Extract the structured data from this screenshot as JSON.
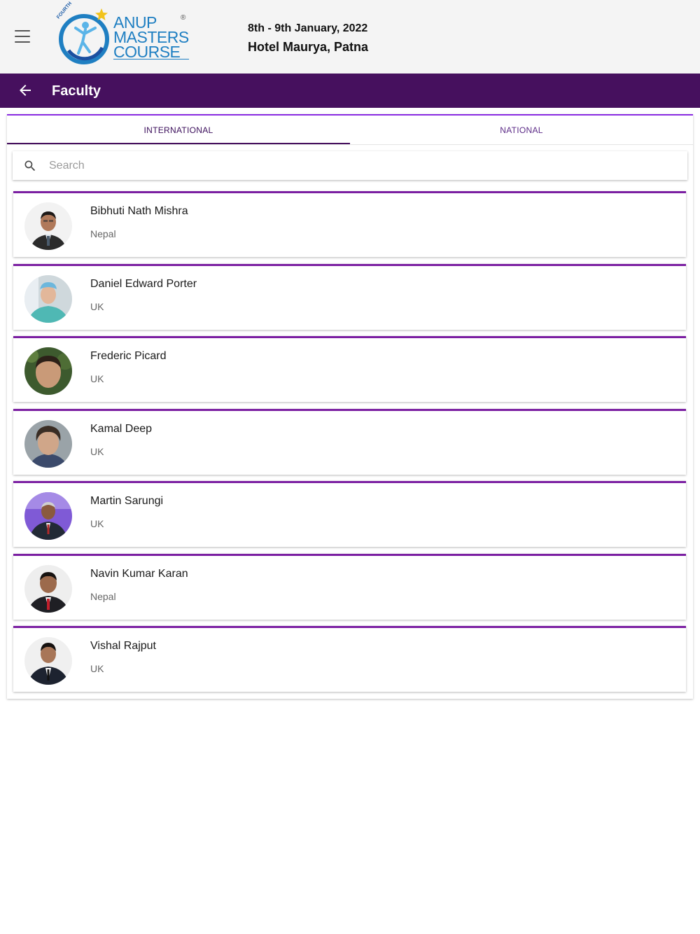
{
  "header": {
    "logo": {
      "words": [
        "ANUP",
        "MASTERS",
        "COURSE"
      ],
      "edition": "FOURTH",
      "mark": "®"
    },
    "event_dates": "8th - 9th January, 2022",
    "event_venue": "Hotel Maurya, Patna"
  },
  "app_bar": {
    "title": "Faculty"
  },
  "tabs": [
    {
      "label": "INTERNATIONAL",
      "active": true
    },
    {
      "label": "NATIONAL",
      "active": false
    }
  ],
  "search": {
    "placeholder": "Search",
    "value": ""
  },
  "faculty": [
    {
      "name": "Bibhuti Nath Mishra",
      "country": "Nepal"
    },
    {
      "name": "Daniel Edward Porter",
      "country": "UK"
    },
    {
      "name": "Frederic Picard",
      "country": "UK"
    },
    {
      "name": "Kamal Deep",
      "country": "UK"
    },
    {
      "name": "Martin Sarungi",
      "country": "UK"
    },
    {
      "name": "Navin Kumar Karan",
      "country": "Nepal"
    },
    {
      "name": "Vishal Rajput",
      "country": "UK"
    }
  ],
  "colors": {
    "app_bar": "#46105e",
    "accent": "#7b1fa2",
    "logo_blue": "#1f7fc2",
    "header_bg": "#f4f4f4"
  }
}
